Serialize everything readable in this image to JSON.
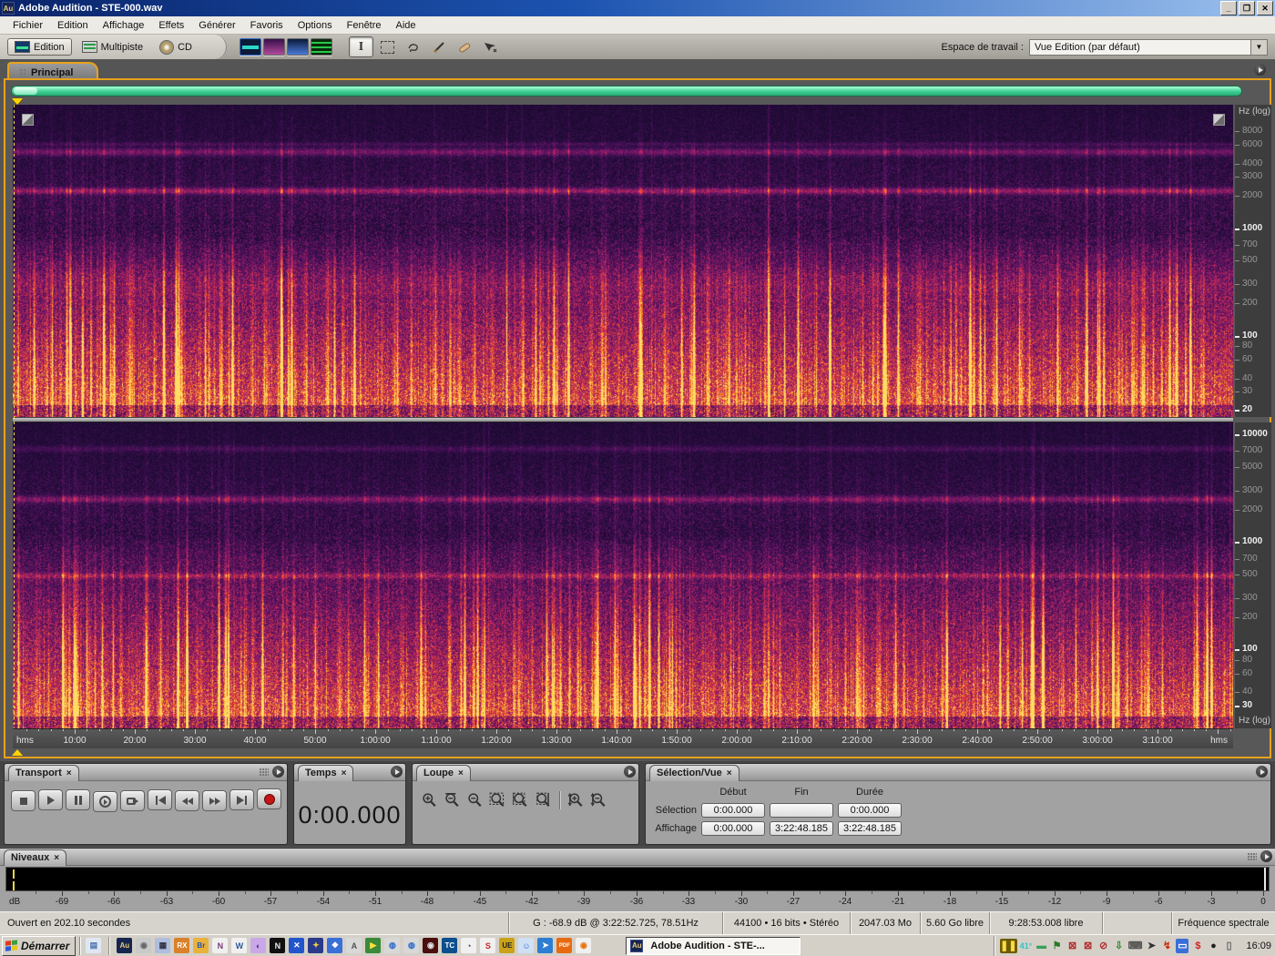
{
  "window": {
    "title": "Adobe Audition - STE-000.wav",
    "icon_text": "Au"
  },
  "menu": {
    "items": [
      "Fichier",
      "Edition",
      "Affichage",
      "Effets",
      "Générer",
      "Favoris",
      "Options",
      "Fenêtre",
      "Aide"
    ]
  },
  "toolbar": {
    "modes": [
      {
        "label": "Edition",
        "active": true,
        "icon": "waveform-edit-mode-icon"
      },
      {
        "label": "Multipiste",
        "active": false,
        "icon": "multitrack-mode-icon"
      },
      {
        "label": "CD",
        "active": false,
        "icon": "cd-mode-icon"
      }
    ],
    "views": [
      {
        "name": "waveform-display-icon"
      },
      {
        "name": "spectral-frequency-display-icon"
      },
      {
        "name": "spectral-pan-display-icon"
      },
      {
        "name": "spectral-phase-display-icon"
      }
    ],
    "tools": [
      {
        "name": "time-selection-tool-icon",
        "active": true,
        "glyph": "ibeam"
      },
      {
        "name": "marquee-selection-tool-icon",
        "active": false,
        "glyph": "marquee"
      },
      {
        "name": "lasso-selection-tool-icon",
        "active": false,
        "glyph": "lasso"
      },
      {
        "name": "effects-paintbrush-tool-icon",
        "active": false,
        "glyph": "brush"
      },
      {
        "name": "spot-healing-brush-tool-icon",
        "active": false,
        "glyph": "bandaid"
      },
      {
        "name": "scrub-tool-icon",
        "active": false,
        "glyph": "scrub"
      }
    ],
    "workspace": {
      "label": "Espace de travail :",
      "value": "Vue Edition (par défaut)"
    }
  },
  "main": {
    "tab": "Principal",
    "axis_unit": "Hz (log)",
    "freq_labels_ch1": [
      {
        "f": "8000"
      },
      {
        "f": "6000"
      },
      {
        "f": "4000"
      },
      {
        "f": "3000"
      },
      {
        "f": "2000"
      },
      {
        "f": "1000",
        "bold": true
      },
      {
        "f": "700"
      },
      {
        "f": "500"
      },
      {
        "f": "300"
      },
      {
        "f": "200"
      },
      {
        "f": "100",
        "bold": true
      },
      {
        "f": "80"
      },
      {
        "f": "60"
      },
      {
        "f": "40"
      },
      {
        "f": "30"
      },
      {
        "f": "20",
        "bold": true
      }
    ],
    "freq_labels_ch2": [
      {
        "f": "10000",
        "bold": true
      },
      {
        "f": "7000"
      },
      {
        "f": "5000"
      },
      {
        "f": "3000"
      },
      {
        "f": "2000"
      },
      {
        "f": "1000",
        "bold": true
      },
      {
        "f": "700"
      },
      {
        "f": "500"
      },
      {
        "f": "300"
      },
      {
        "f": "200"
      },
      {
        "f": "100",
        "bold": true
      },
      {
        "f": "80"
      },
      {
        "f": "60"
      },
      {
        "f": "40"
      },
      {
        "f": "30",
        "bold": true
      }
    ],
    "ruler": {
      "unit": "hms",
      "ticks": [
        "10:00",
        "20:00",
        "30:00",
        "40:00",
        "50:00",
        "1:00:00",
        "1:10:00",
        "1:20:00",
        "1:30:00",
        "1:40:00",
        "1:50:00",
        "2:00:00",
        "2:10:00",
        "2:20:00",
        "2:30:00",
        "2:40:00",
        "2:50:00",
        "3:00:00",
        "3:10:00"
      ],
      "total_minutes": 202.8
    }
  },
  "transport": {
    "title": "Transport",
    "buttons": [
      {
        "name": "stop-button",
        "glyph": "stop"
      },
      {
        "name": "play-button",
        "glyph": "play"
      },
      {
        "name": "pause-button",
        "glyph": "pause"
      },
      {
        "name": "play-from-cursor-button",
        "glyph": "playcirc"
      },
      {
        "name": "loop-play-button",
        "glyph": "loop"
      },
      {
        "name": "go-to-start-button",
        "glyph": "tostart"
      },
      {
        "name": "rewind-button",
        "glyph": "rew"
      },
      {
        "name": "fast-forward-button",
        "glyph": "ffwd"
      },
      {
        "name": "go-to-end-button",
        "glyph": "toend"
      },
      {
        "name": "record-button",
        "glyph": "record"
      }
    ]
  },
  "temps": {
    "title": "Temps",
    "value": "0:00.000"
  },
  "loupe": {
    "title": "Loupe",
    "buttons": [
      {
        "name": "zoom-in-button",
        "glyph": "plus",
        "sep_before": false
      },
      {
        "name": "zoom-out-full-button",
        "glyph": "bar",
        "sep_before": false
      },
      {
        "name": "zoom-out-button",
        "glyph": "minus",
        "sep_before": false
      },
      {
        "name": "zoom-to-selection-button",
        "glyph": "sel",
        "sep_before": false
      },
      {
        "name": "zoom-selection-left-button",
        "glyph": "sell",
        "sep_before": false
      },
      {
        "name": "zoom-selection-right-button",
        "glyph": "selr",
        "sep_before": false
      },
      {
        "name": "zoom-in-vertical-button",
        "glyph": "vplus",
        "sep_before": true
      },
      {
        "name": "zoom-out-vertical-button",
        "glyph": "vminus",
        "sep_before": false
      }
    ]
  },
  "selection_vue": {
    "title": "Sélection/Vue",
    "columns": [
      "Début",
      "Fin",
      "Durée"
    ],
    "rows": [
      {
        "label": "Sélection",
        "values": [
          "0:00.000",
          "",
          "0:00.000"
        ]
      },
      {
        "label": "Affichage",
        "values": [
          "0:00.000",
          "3:22:48.185",
          "3:22:48.185"
        ]
      }
    ]
  },
  "niveaux": {
    "title": "Niveaux",
    "unit": "dB",
    "db_min": -69,
    "db_max": 0,
    "db_step": 3
  },
  "status": {
    "segments": [
      "Ouvert en 202.10 secondes",
      "G : -68.9 dB @ 3:22:52.725, 78.51Hz",
      "44100 • 16 bits • Stéréo",
      "2047.03 Mo",
      "5.60 Go libre",
      "9:28:53.008 libre",
      "",
      "Fréquence spectrale"
    ]
  },
  "taskbar": {
    "start_label": "Démarrer",
    "task_button": {
      "label": "Adobe Audition - STE-...",
      "icon_text": "Au"
    },
    "clock": "16:09",
    "quicklaunch": [
      {
        "name": "show-desktop-icon",
        "bg": "#dfe8f2",
        "fg": "#4a6fae",
        "ch": "▤",
        "sep_after": true
      },
      {
        "name": "audition-quicklaunch-icon",
        "bg": "#16254f",
        "fg": "#e8c87a",
        "ch": "Au"
      },
      {
        "name": "player-icon",
        "bg": "#c9c9c9",
        "fg": "#666666",
        "ch": "◉"
      },
      {
        "name": "calculator-icon",
        "bg": "#aebede",
        "fg": "#333344",
        "ch": "▦"
      },
      {
        "name": "recordnow-icon",
        "bg": "#d9822b",
        "fg": "#ffffff",
        "ch": "RX"
      },
      {
        "name": "bridge-icon",
        "bg": "#e8b23c",
        "fg": "#2255aa",
        "ch": "Br"
      },
      {
        "name": "onenote-icon",
        "bg": "#f0f0f0",
        "fg": "#7a3b76",
        "ch": "N"
      },
      {
        "name": "word-icon",
        "bg": "#f0f0f0",
        "fg": "#2b579a",
        "ch": "W"
      },
      {
        "name": "planet-icon",
        "bg": "#caa8e8",
        "fg": "#5a2a9a",
        "ch": "◐"
      },
      {
        "name": "netscape-icon",
        "bg": "#101010",
        "fg": "#e8e8e8",
        "ch": "N"
      },
      {
        "name": "xnview-icon",
        "bg": "#2255cc",
        "fg": "#ffffff",
        "ch": "✕"
      },
      {
        "name": "starburst-icon",
        "bg": "#2a3a8a",
        "fg": "#f0d040",
        "ch": "✦"
      },
      {
        "name": "pricetag-icon",
        "bg": "#3a6fd8",
        "fg": "#ffffff",
        "ch": "❖"
      },
      {
        "name": "acrobat-gray-icon",
        "bg": "#d8d8d8",
        "fg": "#555555",
        "ch": "A"
      },
      {
        "name": "media-tool-icon",
        "bg": "#3a8a3a",
        "fg": "#ffe040",
        "ch": "▶"
      },
      {
        "name": "globe-icon-1",
        "bg": "#d8d8d8",
        "fg": "#2a6ac4",
        "ch": "◍"
      },
      {
        "name": "globe-icon-2",
        "bg": "#d8d8d8",
        "fg": "#2a6ac4",
        "ch": "◍"
      },
      {
        "name": "camera-icon",
        "bg": "#4a0e0e",
        "fg": "#e0e0e0",
        "ch": "◉"
      },
      {
        "name": "turbocad-icon",
        "bg": "#0b4f8e",
        "fg": "#ffffff",
        "ch": "TC"
      },
      {
        "name": "dial-icon",
        "bg": "#f0f0f0",
        "fg": "#333333",
        "ch": "◔"
      },
      {
        "name": "sbp-icon",
        "bg": "#f0f0f0",
        "fg": "#cc2222",
        "ch": "S"
      },
      {
        "name": "ultraedit-icon",
        "bg": "#caa21a",
        "fg": "#222222",
        "ch": "UE"
      },
      {
        "name": "messenger-icon",
        "bg": "#cfe0f4",
        "fg": "#3a6fd8",
        "ch": "☺"
      },
      {
        "name": "thunderbird-icon",
        "bg": "#2d7dd2",
        "fg": "#ffffff",
        "ch": "➤"
      },
      {
        "name": "pdf-icon",
        "bg": "#e86a10",
        "fg": "#ffffff",
        "ch": "PDF"
      },
      {
        "name": "wmp-icon",
        "bg": "#f0f0f0",
        "fg": "#e8720c",
        "ch": "◉"
      }
    ],
    "tray": [
      {
        "name": "volume-meter-tray-icon",
        "bg": "#6b5b00",
        "fg": "#ffd84a",
        "ch": "❚❚"
      },
      {
        "name": "temperature-tray-indicator",
        "bg": "none",
        "fg": "#2fc4c4",
        "ch": "41°"
      },
      {
        "name": "minimized-app-tray-icon",
        "bg": "none",
        "fg": "#3aa05a",
        "ch": "▬"
      },
      {
        "name": "flag-tray-icon",
        "bg": "none",
        "fg": "#2a7a2a",
        "ch": "⚑"
      },
      {
        "name": "network-offline-tray-icon-1",
        "bg": "none",
        "fg": "#b03030",
        "ch": "⊠"
      },
      {
        "name": "network-offline-tray-icon-2",
        "bg": "none",
        "fg": "#b03030",
        "ch": "⊠"
      },
      {
        "name": "blocked-connection-tray-icon",
        "bg": "none",
        "fg": "#b03030",
        "ch": "⊘"
      },
      {
        "name": "update-tray-icon",
        "bg": "none",
        "fg": "#2a8a2a",
        "ch": "⇩"
      },
      {
        "name": "scanner-tray-icon",
        "bg": "none",
        "fg": "#555555",
        "ch": "⌨"
      },
      {
        "name": "pointer-tray-icon",
        "bg": "none",
        "fg": "#333333",
        "ch": "➤"
      },
      {
        "name": "power-tray-icon",
        "bg": "none",
        "fg": "#cc2200",
        "ch": "↯"
      },
      {
        "name": "display-tray-icon",
        "bg": "#3a6fd8",
        "fg": "#ffffff",
        "ch": "▭"
      },
      {
        "name": "currency-tray-icon",
        "bg": "none",
        "fg": "#cc2222",
        "ch": "$"
      },
      {
        "name": "mouse-tray-icon",
        "bg": "none",
        "fg": "#222222",
        "ch": "●"
      },
      {
        "name": "notes-tray-icon",
        "bg": "none",
        "fg": "#666666",
        "ch": "▯"
      }
    ]
  }
}
